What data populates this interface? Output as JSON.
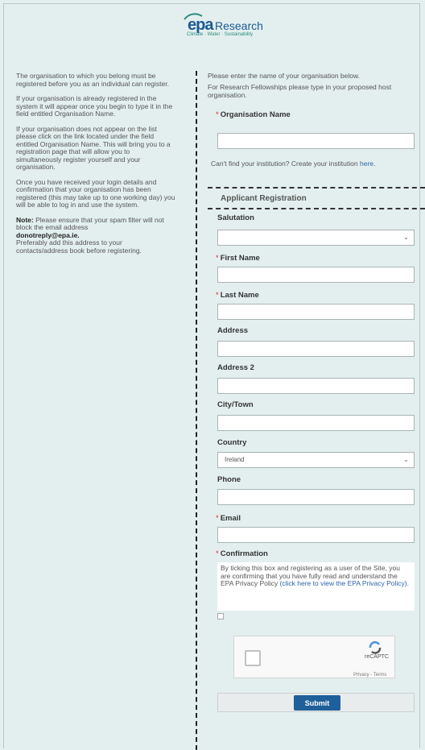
{
  "logo": {
    "brand": "epa",
    "name": "Research",
    "tagline": "Climate · Water · Sustainability"
  },
  "left_panel": {
    "p1": "The organisation to which you belong must be registered before you as an individual can register.",
    "p2": "If your organisation is already registered in the system it will appear once you begin to type it in the field entitled Organisation Name.",
    "p3": "If your organisation does not appear on the list please click on the link located under the field entitled Organisation Name. This will bring you to a registration page that will allow you to simultaneously register yourself and your organisation.",
    "p4": "Once you have received your login details and confirmation that your organisation has been registered (this may take up to one working day) you will be able to log in and use the system.",
    "note_label": "Note:",
    "note_text": " Please ensure that your spam filter will not block the email address",
    "note_email": "donotreply@epa.ie.",
    "note_text2": "Preferably add this address to your contacts/address book before registering."
  },
  "org": {
    "intro1": "Please enter the name of your organisation below.",
    "intro2": "For Research Fellowships please type in your proposed host organisation.",
    "label": "Organisation Name",
    "cant_find": "Can't find your institution? Create your institution",
    "here": "here."
  },
  "section_title": "Applicant Registration",
  "fields": {
    "salutation": "Salutation",
    "first_name": "First Name",
    "last_name": "Last Name",
    "address": "Address",
    "address2": "Address 2",
    "city": "City/Town",
    "country": "Country",
    "country_value": "Ireland",
    "phone": "Phone",
    "email": "Email",
    "confirmation": "Confirmation"
  },
  "consent": {
    "text": "By ticking this box and registering as a user of the Site, you are confirming that you have fully read and understand the EPA Privacy Policy",
    "link": "(click here to view the EPA Privacy Policy)."
  },
  "captcha": {
    "brand": "reCAPTC",
    "terms": "Privacy - Terms"
  },
  "submit_label": "Submit"
}
